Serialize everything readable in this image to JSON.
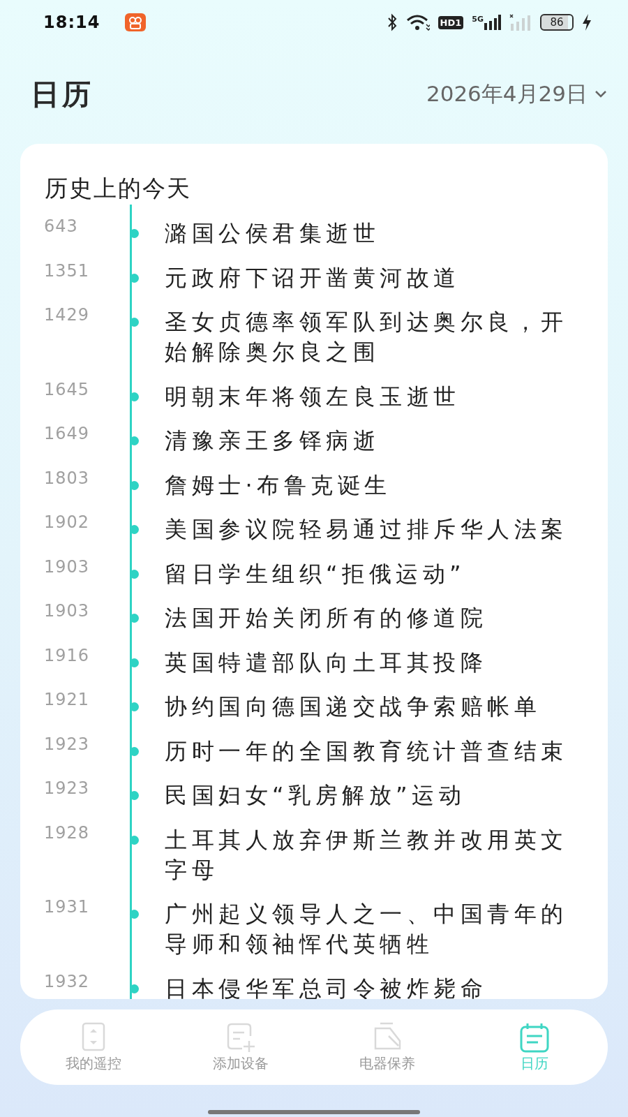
{
  "status_bar": {
    "time": "18:14",
    "hd_label": "HD1",
    "network_label": "5G",
    "battery": "86"
  },
  "header": {
    "title": "日历",
    "date": "2026年4月29日"
  },
  "history_card": {
    "title": "历史上的今天",
    "events": [
      {
        "year": "643",
        "text": "潞国公侯君集逝世"
      },
      {
        "year": "1351",
        "text": "元政府下诏开凿黄河故道"
      },
      {
        "year": "1429",
        "text": "圣女贞德率领军队到达奥尔良，开始解除奥尔良之围"
      },
      {
        "year": "1645",
        "text": "明朝末年将领左良玉逝世"
      },
      {
        "year": "1649",
        "text": "清豫亲王多铎病逝"
      },
      {
        "year": "1803",
        "text": "詹姆士·布鲁克诞生"
      },
      {
        "year": "1902",
        "text": "美国参议院轻易通过排斥华人法案"
      },
      {
        "year": "1903",
        "text": "留日学生组织“拒俄运动”"
      },
      {
        "year": "1903",
        "text": "法国开始关闭所有的修道院"
      },
      {
        "year": "1916",
        "text": "英国特遣部队向土耳其投降"
      },
      {
        "year": "1921",
        "text": "协约国向德国递交战争索赔帐单"
      },
      {
        "year": "1923",
        "text": "历时一年的全国教育统计普查结束"
      },
      {
        "year": "1923",
        "text": "民国妇女“乳房解放”运动"
      },
      {
        "year": "1928",
        "text": "土耳其人放弃伊斯兰教并改用英文字母"
      },
      {
        "year": "1931",
        "text": "广州起义领导人之一、中国青年的导师和领袖恽代英牺牲"
      },
      {
        "year": "1932",
        "text": "日本侵华军总司令被炸毙命"
      }
    ]
  },
  "bottom_nav": [
    {
      "kind": "remote",
      "label": "我的遥控",
      "selected": false
    },
    {
      "kind": "add",
      "label": "添加设备",
      "selected": false
    },
    {
      "kind": "care",
      "label": "电器保养",
      "selected": false
    },
    {
      "kind": "calendar",
      "label": "日历",
      "selected": true
    }
  ]
}
